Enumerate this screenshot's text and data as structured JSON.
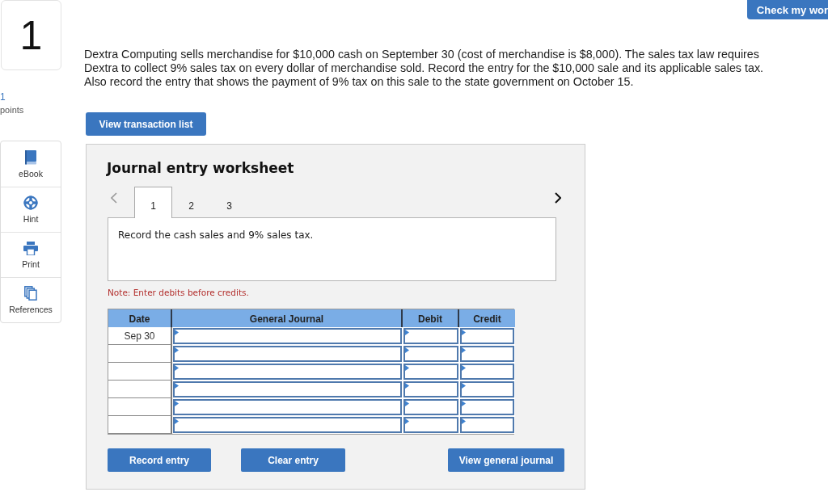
{
  "question": {
    "number": "1",
    "points": "1",
    "points_label": "points"
  },
  "check_button": "Check my wor",
  "sidebar": {
    "items": [
      {
        "label": "eBook"
      },
      {
        "label": "Hint"
      },
      {
        "label": "Print"
      },
      {
        "label": "References"
      }
    ]
  },
  "problem_text": "Dextra Computing sells merchandise for $10,000 cash on September 30 (cost of merchandise is $8,000). The sales tax law requires Dextra to collect 9% sales tax on every dollar of merchandise sold. Record the entry for the $10,000 sale and its applicable sales tax. Also record the entry that shows the payment of 9% tax on this sale to the state government on October 15.",
  "transaction_button": "View transaction list",
  "worksheet": {
    "title": "Journal entry worksheet",
    "prev": {
      "disabled": true
    },
    "next": {
      "disabled": false
    },
    "tabs": [
      {
        "label": "1",
        "selected": true
      },
      {
        "label": "2",
        "selected": false
      },
      {
        "label": "3",
        "selected": false
      }
    ],
    "instruction": "Record the cash sales and 9% sales tax.",
    "note": "Note: Enter debits before credits.",
    "table": {
      "columns": [
        "Date",
        "General Journal",
        "Debit",
        "Credit"
      ],
      "rows": [
        {
          "date": "Sep 30"
        },
        {},
        {},
        {},
        {},
        {}
      ]
    },
    "buttons": [
      "Record entry",
      "Clear entry",
      "View general journal"
    ]
  }
}
